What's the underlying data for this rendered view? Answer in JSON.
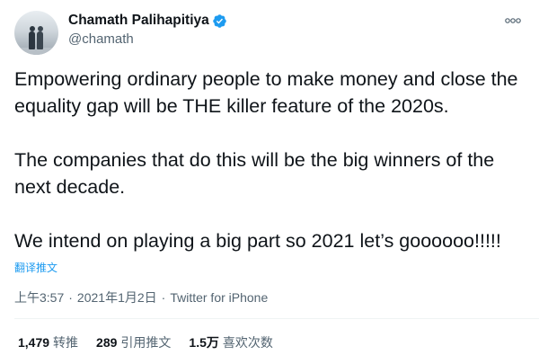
{
  "user": {
    "display_name": "Chamath Palihapitiya",
    "handle": "@chamath",
    "verified": true
  },
  "icons": {
    "verified": "verified-badge-icon",
    "more": "more-options-icon"
  },
  "tweet": {
    "paragraphs": [
      "Empowering ordinary people to make money and close the equality gap will be THE killer feature of the 2020s.",
      "The companies that do this will be the big winners of the next decade.",
      "We intend on playing a big part so 2021 let’s goooooo!!!!!"
    ],
    "translate_label": "翻译推文",
    "time": "上午3:57",
    "date": "2021年1月2日",
    "separator": "·",
    "source": "Twitter for iPhone"
  },
  "stats": {
    "retweets": {
      "value": "1,479",
      "label": "转推"
    },
    "quotes": {
      "value": "289",
      "label": "引用推文"
    },
    "likes": {
      "value": "1.5万",
      "label": "喜欢次数"
    }
  },
  "colors": {
    "accent": "#1d9bf0",
    "text": "#0f1419",
    "muted": "#536471"
  }
}
